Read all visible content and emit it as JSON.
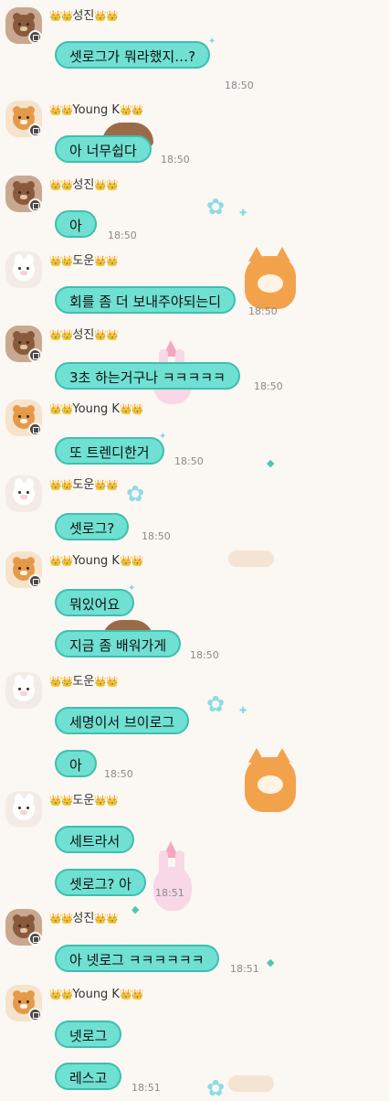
{
  "crowns": "👑👑",
  "messages": {
    "m1": {
      "name": "성진",
      "text": "셋로그가 뭐라했지…?",
      "time": "18:50"
    },
    "m2": {
      "name": "Young K",
      "text": "아 너무쉽다",
      "time": "18:50"
    },
    "m3": {
      "name": "성진",
      "text": "아",
      "time": "18:50"
    },
    "m4": {
      "name": "도운",
      "text": "회를 좀 더 보내주야되는디",
      "time": "18:50"
    },
    "m5": {
      "name": "성진",
      "text": "3초 하는거구나 ㅋㅋㅋㅋㅋ",
      "time": "18:50"
    },
    "m6": {
      "name": "Young K",
      "text": "또 트렌디한거",
      "time": "18:50"
    },
    "m7": {
      "name": "도운",
      "text": "셋로그?",
      "time": "18:50"
    },
    "m8": {
      "name": "Young K",
      "text": "뭐있어요",
      "text2": "지금 좀 배워가게",
      "time": "18:50"
    },
    "m9": {
      "name": "도운",
      "text": "세명이서 브이로그",
      "text2": "아",
      "time": "18:50"
    },
    "m10": {
      "name": "도운",
      "text": "세트라서",
      "text2": "셋로그? 아",
      "time": "18:51"
    },
    "m11": {
      "name": "성진",
      "text": "아 넷로그 ㅋㅋㅋㅋㅋㅋ",
      "time": "18:51"
    },
    "m12": {
      "name": "Young K",
      "text": "넷로그",
      "text2": "레스고",
      "time": "18:51"
    }
  },
  "icons": {
    "avatar_bear": "bear-avatar-icon",
    "avatar_shiba": "shiba-avatar-icon",
    "avatar_bunny": "bunny-avatar-icon",
    "decor": "sparkle-icon"
  },
  "colors": {
    "bubble": "#6fe0d2",
    "bubble_border": "#3dbfb0",
    "background": "#fbf7f3"
  }
}
